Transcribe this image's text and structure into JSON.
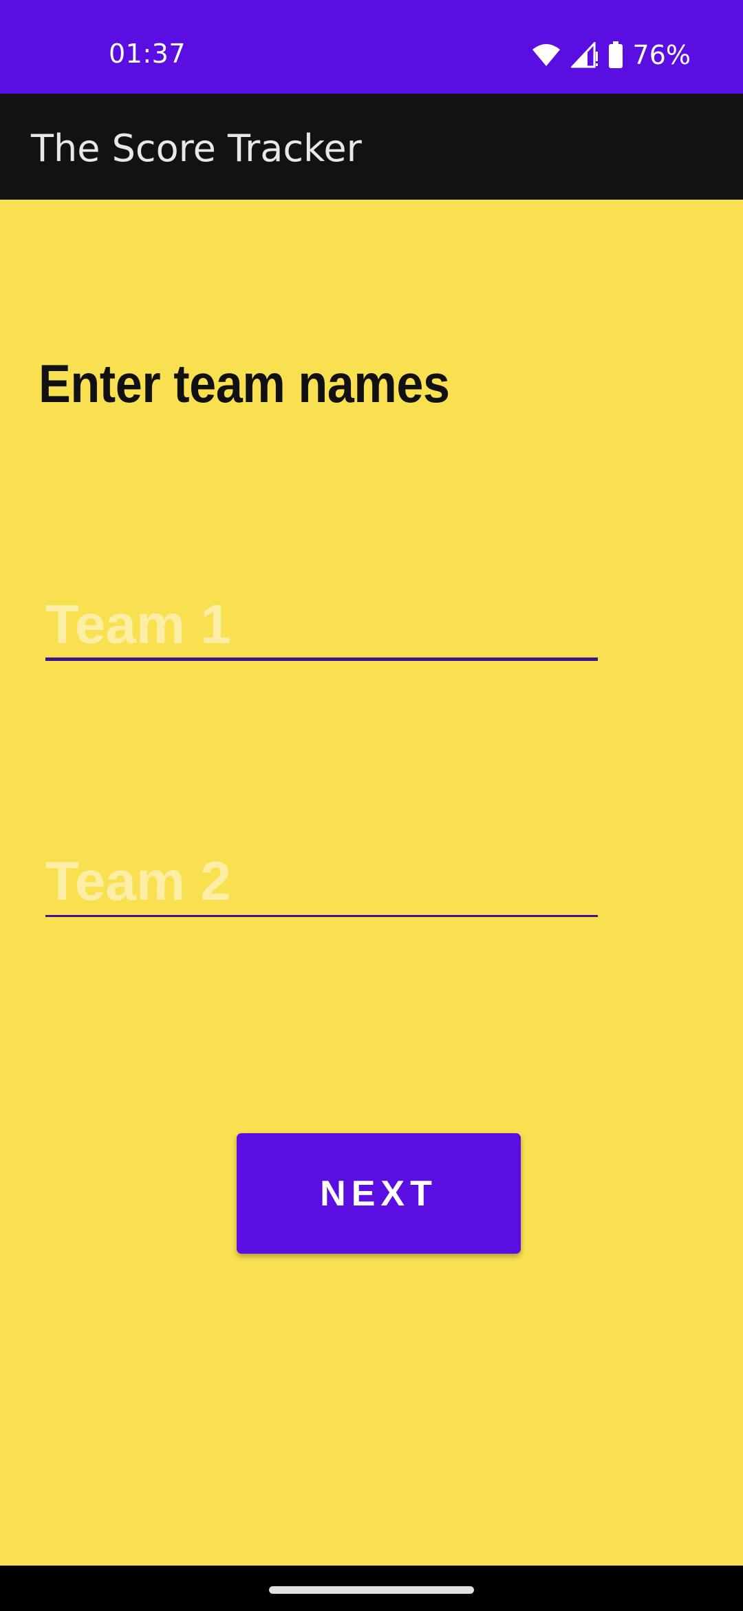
{
  "status_bar": {
    "time": "01:37",
    "battery_percent": "76%",
    "icons": [
      "wifi-icon",
      "signal-icon",
      "battery-icon"
    ],
    "background": "#5b0ee2"
  },
  "app_bar": {
    "title": "The Score Tracker",
    "background": "#121212"
  },
  "main": {
    "heading": "Enter team names",
    "background": "#f9e051",
    "team1": {
      "value": "",
      "placeholder": "Team 1"
    },
    "team2": {
      "value": "",
      "placeholder": "Team 2"
    },
    "next_label": "NEXT",
    "accent": "#5b0ee2"
  }
}
